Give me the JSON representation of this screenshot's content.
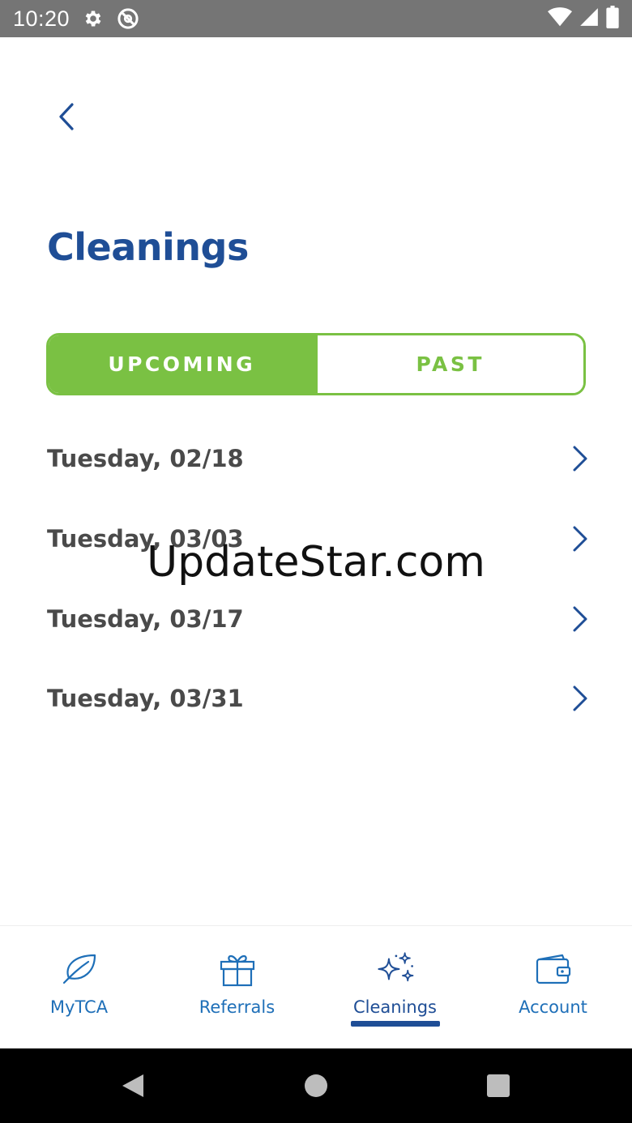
{
  "status_bar": {
    "time": "10:20",
    "icons_left": [
      "gear-icon",
      "no-sync-icon"
    ],
    "icons_right": [
      "wifi-icon",
      "signal-icon",
      "battery-icon"
    ]
  },
  "header": {
    "back_icon": "chevron-left-icon",
    "title": "Cleanings"
  },
  "tabs": {
    "items": [
      {
        "label": "UPCOMING",
        "active": true
      },
      {
        "label": "PAST",
        "active": false
      }
    ]
  },
  "cleanings": {
    "items": [
      {
        "label": "Tuesday, 02/18"
      },
      {
        "label": "Tuesday, 03/03"
      },
      {
        "label": "Tuesday, 03/17"
      },
      {
        "label": "Tuesday, 03/31"
      }
    ]
  },
  "watermark": "UpdateStar.com",
  "bottom_nav": {
    "items": [
      {
        "label": "MyTCA",
        "icon": "leaf-icon",
        "active": false
      },
      {
        "label": "Referrals",
        "icon": "gift-icon",
        "active": false
      },
      {
        "label": "Cleanings",
        "icon": "sparkles-icon",
        "active": true
      },
      {
        "label": "Account",
        "icon": "wallet-icon",
        "active": false
      }
    ]
  },
  "system_nav": {
    "items": [
      "back-triangle-icon",
      "home-circle-icon",
      "recents-square-icon"
    ]
  },
  "colors": {
    "primary_blue": "#1f4e96",
    "link_blue": "#1e6fb8",
    "green": "#7ac143",
    "text_gray": "#4a4a4a",
    "status_bar": "#757575"
  }
}
